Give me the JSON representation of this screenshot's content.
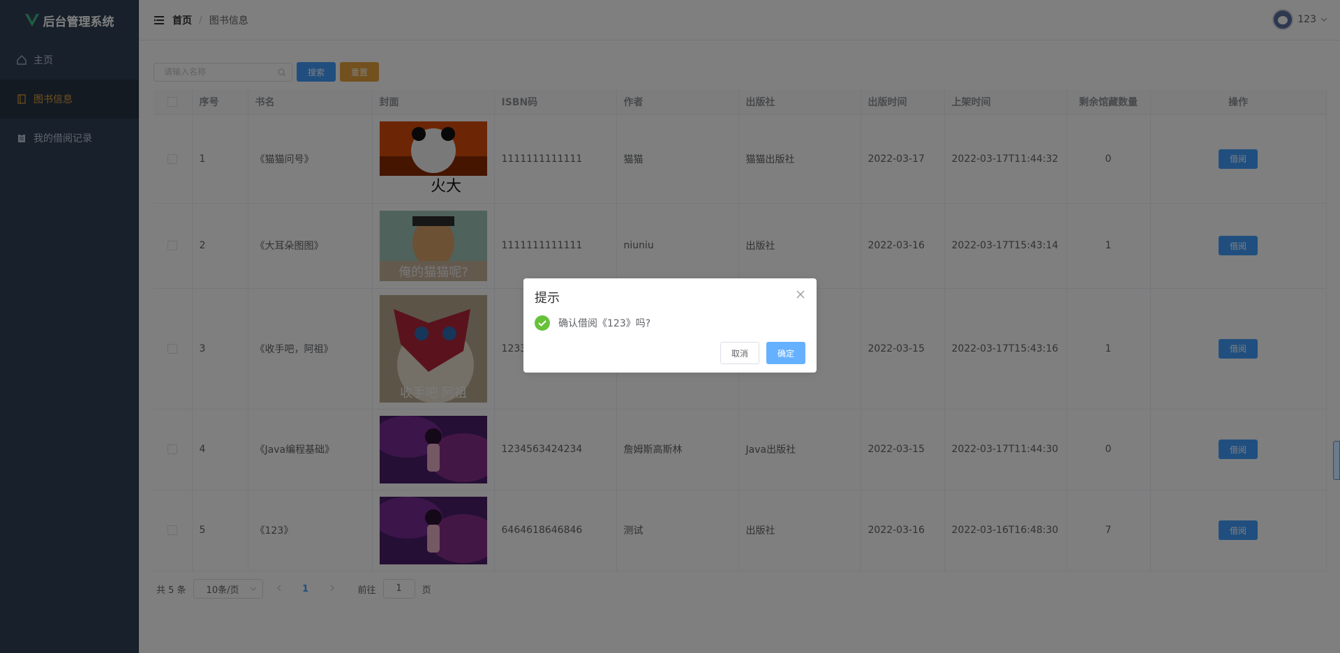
{
  "app": {
    "title": "后台管理系统"
  },
  "sidebar": {
    "items": [
      {
        "label": "主页",
        "icon": "home-icon",
        "active": false
      },
      {
        "label": "图书信息",
        "icon": "book-icon",
        "active": true
      },
      {
        "label": "我的借阅记录",
        "icon": "clipboard-icon",
        "active": false
      }
    ]
  },
  "header": {
    "breadcrumb": {
      "home": "首页",
      "separator": "/",
      "current": "图书信息"
    },
    "user": {
      "name": "123"
    }
  },
  "toolbar": {
    "search_placeholder": "请输入名称",
    "search_value": "",
    "search_label": "搜索",
    "reset_label": "重置"
  },
  "table": {
    "columns": [
      "序号",
      "书名",
      "封面",
      "ISBN码",
      "作者",
      "出版社",
      "出版时间",
      "上架时间",
      "剩余馆藏数量",
      "操作"
    ],
    "rows": [
      {
        "id": "1",
        "name": "《猫猫问号》",
        "cover": "panda-meme-cover",
        "cover_caption": "火大",
        "isbn": "1111111111111",
        "author": "猫猫",
        "publisher": "猫猫出版社",
        "pub_date": "2022-03-17",
        "shelf_time": "2022-03-17T11:44:32",
        "stock": "0",
        "action": "借阅"
      },
      {
        "id": "2",
        "name": "《大耳朵图图》",
        "cover": "cartoon-man-cover",
        "cover_caption": "俺的猫猫呢?",
        "isbn": "1111111111111",
        "author": "niuniu",
        "publisher": "出版社",
        "pub_date": "2022-03-16",
        "shelf_time": "2022-03-17T15:43:14",
        "stock": "1",
        "action": "借阅"
      },
      {
        "id": "3",
        "name": "《收手吧，阿祖》",
        "cover": "cat-mask-cover",
        "cover_caption": "收手吧 阿祖",
        "isbn": "1233",
        "author": "",
        "publisher": "",
        "pub_date": "2022-03-15",
        "shelf_time": "2022-03-17T15:43:16",
        "stock": "1",
        "action": "借阅"
      },
      {
        "id": "4",
        "name": "《Java编程基础》",
        "cover": "anime-girl-cover",
        "cover_caption": "",
        "isbn": "1234563424234",
        "author": "詹姆斯高斯林",
        "publisher": "Java出版社",
        "pub_date": "2022-03-15",
        "shelf_time": "2022-03-17T11:44:30",
        "stock": "0",
        "action": "借阅"
      },
      {
        "id": "5",
        "name": "《123》",
        "cover": "anime-girl-cover",
        "cover_caption": "",
        "isbn": "6464618646846",
        "author": "测试",
        "publisher": "出版社",
        "pub_date": "2022-03-16",
        "shelf_time": "2022-03-16T16:48:30",
        "stock": "7",
        "action": "借阅"
      }
    ]
  },
  "pagination": {
    "total_text": "共 5 条",
    "page_size": "10条/页",
    "current_page": "1",
    "goto_prefix": "前往",
    "goto_value": "1",
    "goto_suffix": "页"
  },
  "dialog": {
    "title": "提示",
    "message": "确认借阅《123》吗?",
    "cancel_label": "取消",
    "confirm_label": "确定"
  },
  "colors": {
    "sidebar_bg": "#304156",
    "active_menu": "#e6a23c",
    "primary": "#409eff",
    "warning": "#e6a23c",
    "success": "#67c23a"
  }
}
